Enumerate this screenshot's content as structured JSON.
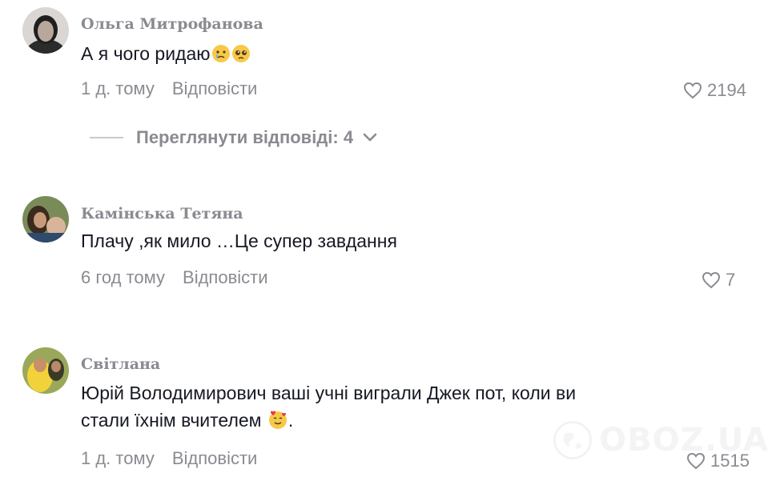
{
  "comments": [
    {
      "author": "Ольга Митрофанова",
      "text": "А я чого ридаю",
      "emojis": [
        "crying-face-emoji",
        "pleading-face-emoji"
      ],
      "time": "1 д. тому",
      "reply_label": "Відповісти",
      "likes": "2194"
    },
    {
      "author": "Камінська Тетяна",
      "text": "Плачу ,як мило …Це супер завдання",
      "time": "6 год тому",
      "reply_label": "Відповісти",
      "likes": "7"
    },
    {
      "author": "Світлана",
      "text_line1": "Юрій Володимирович ваші учні виграли Джек пот, коли ви",
      "text_line2": "стали їхнім вчителем",
      "text_line2_end": ".",
      "emojis": [
        "smiling-face-with-hearts-emoji"
      ],
      "time": "1 д. тому",
      "reply_label": "Відповісти",
      "likes": "1515"
    }
  ],
  "view_replies": {
    "label": "Переглянути відповіді: 4",
    "icon": "chevron-down-icon"
  },
  "watermark": {
    "text": "OBOZ.UA",
    "icon": "globe-logo-icon"
  },
  "colors": {
    "text": "#161823",
    "muted": "#8a8b91",
    "background": "#ffffff"
  }
}
